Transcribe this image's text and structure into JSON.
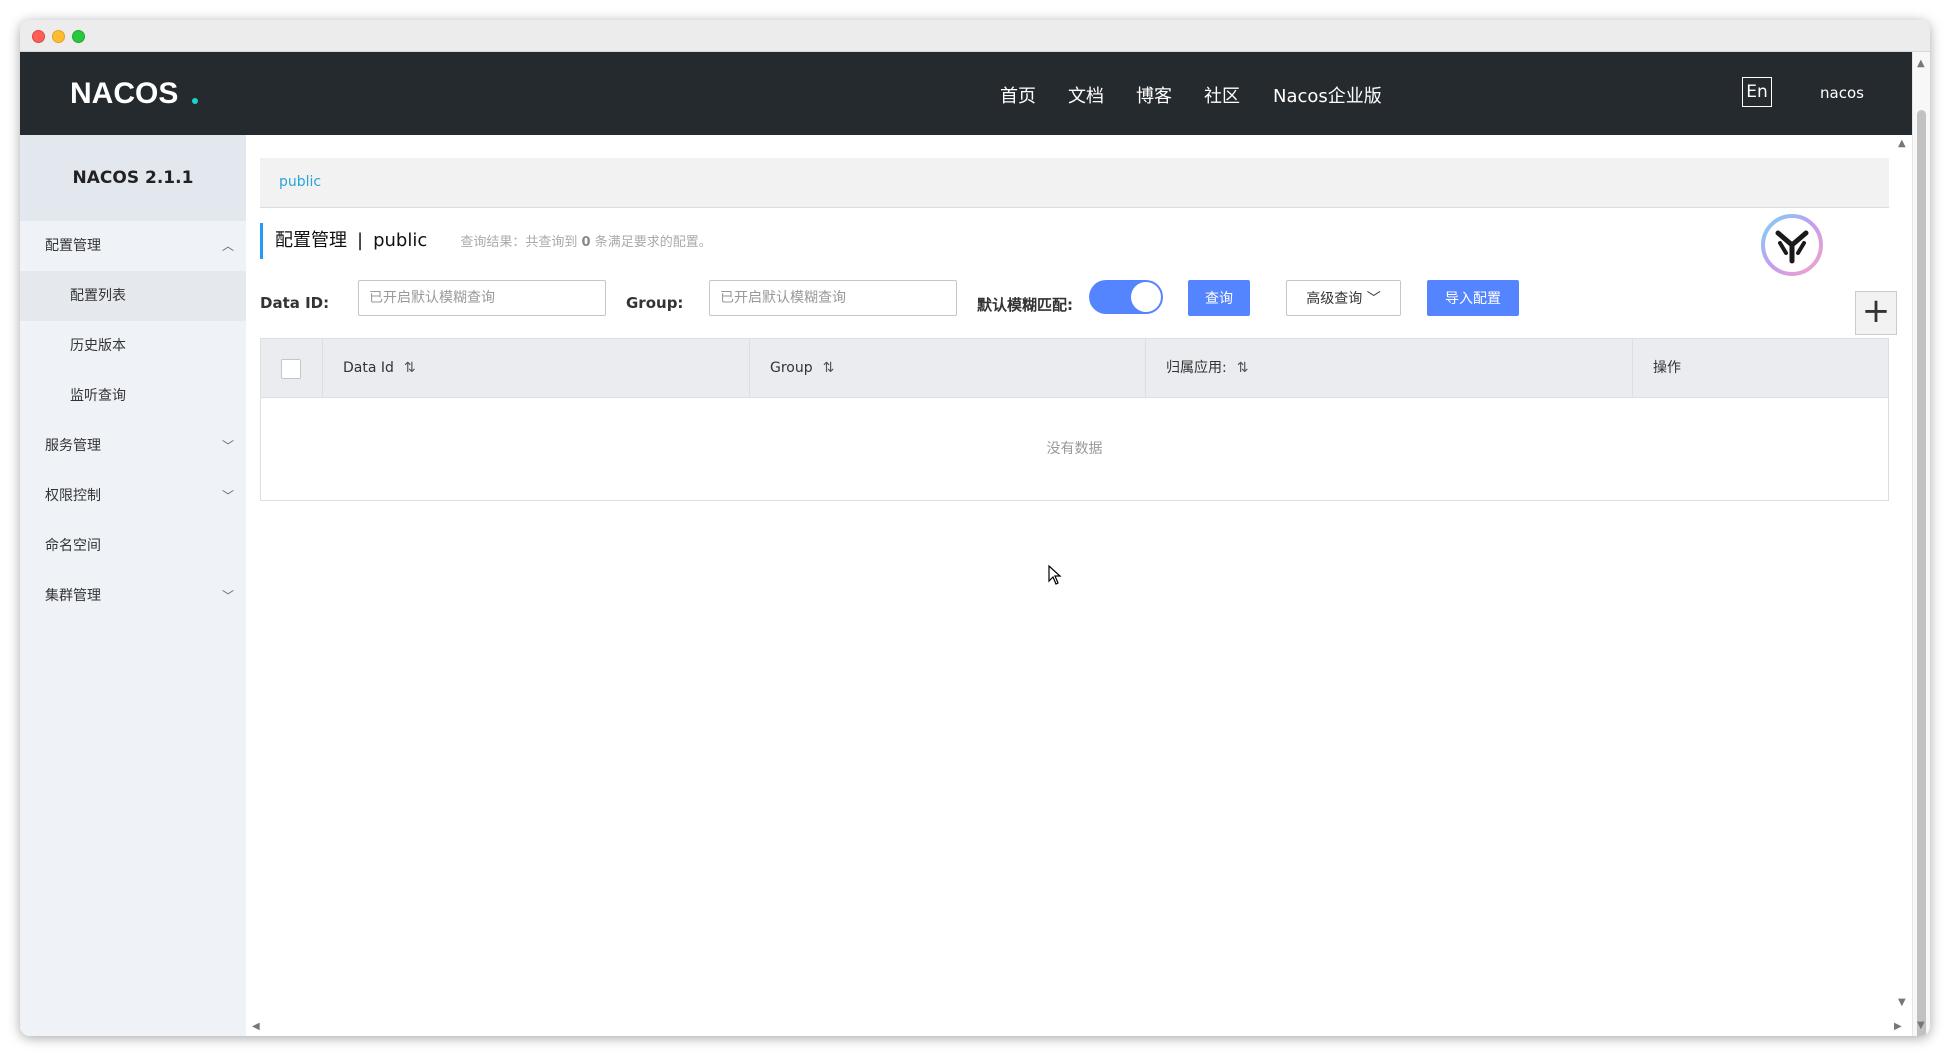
{
  "topnav": {
    "logo_text": "NACOS.",
    "items": [
      "首页",
      "文档",
      "博客",
      "社区",
      "Nacos企业版"
    ],
    "lang_label": "En",
    "user": "nacos"
  },
  "sidebar": {
    "version": "NACOS 2.1.1",
    "menu": [
      {
        "label": "配置管理",
        "expanded": true
      },
      {
        "label": "配置列表",
        "sub": true,
        "active": true
      },
      {
        "label": "历史版本",
        "sub": true
      },
      {
        "label": "监听查询",
        "sub": true
      },
      {
        "label": "服务管理",
        "expanded": false
      },
      {
        "label": "权限控制",
        "expanded": false
      },
      {
        "label": "命名空间"
      },
      {
        "label": "集群管理",
        "expanded": false
      }
    ]
  },
  "breadcrumb": {
    "namespace": "public"
  },
  "page_title": {
    "section": "配置管理",
    "separator": "|",
    "namespace": "public",
    "result_prefix": "查询结果：共查询到",
    "result_count": "0",
    "result_suffix": "条满足要求的配置。"
  },
  "filters": {
    "data_id_label": "Data ID:",
    "data_id_placeholder": "已开启默认模糊查询",
    "group_label": "Group:",
    "group_placeholder": "已开启默认模糊查询",
    "fuzzy_label": "默认模糊匹配:",
    "fuzzy_on": true,
    "query_button": "查询",
    "advanced_button": "高级查询",
    "import_button": "导入配置"
  },
  "table": {
    "columns": [
      {
        "label": "Data Id",
        "sortable": true
      },
      {
        "label": "Group",
        "sortable": true
      },
      {
        "label": "归属应用:",
        "sortable": true
      },
      {
        "label": "操作",
        "sortable": false
      }
    ],
    "empty_text": "没有数据"
  },
  "colors": {
    "primary": "#5584ff",
    "nav_bg": "#252a2f",
    "link": "#2ba4d9"
  }
}
